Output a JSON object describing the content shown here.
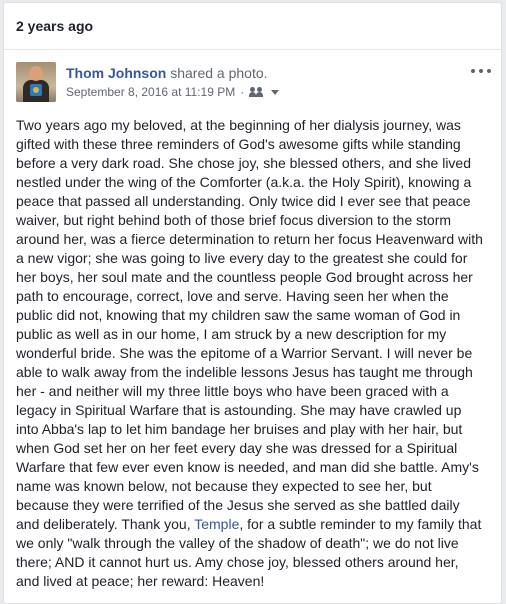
{
  "memory": {
    "title": "2 years ago"
  },
  "post": {
    "author": "Thom Johnson",
    "action": " shared a photo.",
    "timestamp": "September 8, 2016 at 11:19 PM",
    "separator": "·",
    "audience_icon": "friends-icon",
    "more_icon": "more-options-icon",
    "body_part1": "Two years ago my beloved, at the beginning of her dialysis journey, was gifted with these three reminders of God's awesome gifts while standing before a very dark road. She chose joy, she blessed others, and she lived nestled under the wing of the Comforter (a.k.a. the Holy Spirit), knowing a peace that passed all understanding. Only twice did I ever see that peace waiver, but right behind both of those brief focus diversion to the storm around her, was a fierce determination to return her focus Heavenward with a new vigor; she was going to live every day to the greatest she could for her boys, her soul mate and the countless people God brought across her path to encourage, correct, love and serve. Having seen her when the public did not, knowing that my children saw the same woman of God in public as well as in our home, I am struck by a new description for my wonderful bride. She was the epitome of a Warrior Servant. I will never be able to walk away from the indelible lessons Jesus has taught me through her - and neither will my three little boys who have been graced with a legacy in Spiritual Warfare that is astounding. She may have crawled up into Abba's lap to let him bandage her bruises and play with her hair, but when God set her on her feet every day she was dressed for a Spiritual Warfare that few ever even know is needed, and man did she battle. Amy's name was known below, not because they expected to see her, but because they were terrified of the Jesus she served as she battled daily and deliberately. Thank you, ",
    "mention": "Temple",
    "body_part2": ", for a subtle reminder to my family that we only \"walk through the valley of the shadow of death\"; we do not live there; AND it cannot hurt us. Amy chose joy, blessed others around her, and lived at peace; her reward: Heaven!"
  },
  "colors": {
    "link": "#365899",
    "text": "#1d2129",
    "meta": "#616770",
    "background": "#e9ebee"
  }
}
